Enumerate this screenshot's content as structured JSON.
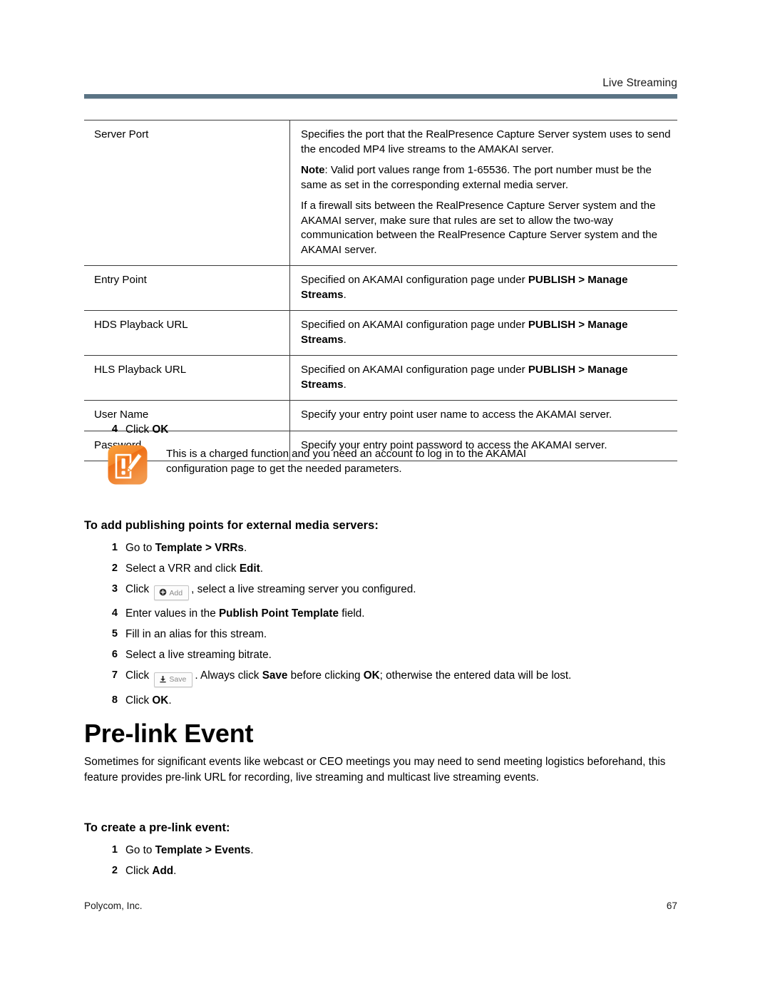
{
  "header": {
    "title": "Live Streaming",
    "rule_color": "#5a7384"
  },
  "table": {
    "rows": [
      {
        "key": "Server Port",
        "paras": [
          {
            "segments": [
              {
                "text": "Specifies the port that the RealPresence Capture Server system uses to send the encoded MP4 live streams to the AMAKAI server.",
                "bold": false
              }
            ]
          },
          {
            "segments": [
              {
                "text": "Note",
                "bold": true
              },
              {
                "text": ": Valid port values range from 1-65536. The port number must be the same as set in the corresponding external media server.",
                "bold": false
              }
            ]
          },
          {
            "segments": [
              {
                "text": "If a firewall sits between the RealPresence Capture Server system and the AKAMAI server, make sure that rules are set to allow the two-way communication between the RealPresence Capture Server system and the AKAMAI server.",
                "bold": false
              }
            ]
          }
        ]
      },
      {
        "key": "Entry Point",
        "paras": [
          {
            "segments": [
              {
                "text": "Specified on AKAMAI configuration page under ",
                "bold": false
              },
              {
                "text": "PUBLISH > Manage Streams",
                "bold": true
              },
              {
                "text": ".",
                "bold": false
              }
            ]
          }
        ]
      },
      {
        "key": "HDS Playback URL",
        "paras": [
          {
            "segments": [
              {
                "text": "Specified on AKAMAI configuration page under ",
                "bold": false
              },
              {
                "text": "PUBLISH > Manage Streams",
                "bold": true
              },
              {
                "text": ".",
                "bold": false
              }
            ]
          }
        ]
      },
      {
        "key": "HLS Playback URL",
        "paras": [
          {
            "segments": [
              {
                "text": "Specified on AKAMAI configuration page under ",
                "bold": false
              },
              {
                "text": "PUBLISH > Manage Streams",
                "bold": true
              },
              {
                "text": ".",
                "bold": false
              }
            ]
          }
        ]
      },
      {
        "key": "User Name",
        "paras": [
          {
            "segments": [
              {
                "text": "Specify your entry point user name to access the AKAMAI server.",
                "bold": false
              }
            ]
          }
        ]
      },
      {
        "key": "Password",
        "paras": [
          {
            "segments": [
              {
                "text": "Specify your entry point password to access the AKAMAI server.",
                "bold": false
              }
            ]
          }
        ]
      }
    ]
  },
  "step_click_ok": {
    "num": "4",
    "prefix": "Click ",
    "bold": "OK"
  },
  "note": {
    "icon": "note-pencil-exclamation-icon",
    "icon_color": "#f07c1e",
    "text": "This is a charged function and you need an account to log in to the AKAMAI configuration page to get the needed parameters."
  },
  "procedure_publishing_points": {
    "heading": "To add publishing points for external media servers:",
    "steps": [
      {
        "num": "1",
        "pre": "Go to ",
        "bold": "Template > VRRs",
        "post": "."
      },
      {
        "num": "2",
        "pre": "Select a VRR and click ",
        "bold": "Edit",
        "post": "."
      },
      {
        "num": "3",
        "pre": "Click ",
        "button": "add",
        "post": ", select a live streaming server you configured."
      },
      {
        "num": "4",
        "pre": "Enter values in the ",
        "bold": "Publish Point Template",
        "post": " field."
      },
      {
        "num": "5",
        "pre": "Fill in an alias for this stream.",
        "bold": "",
        "post": ""
      },
      {
        "num": "6",
        "pre": "Select a live streaming bitrate.",
        "bold": "",
        "post": ""
      },
      {
        "num": "7",
        "pre": "Click ",
        "button": "save",
        "post": ". Always click ",
        "bold2": "Save",
        "mid": " before clicking ",
        "bold3": "OK",
        "tail": "; otherwise the entered data will be lost."
      },
      {
        "num": "8",
        "pre": "Click ",
        "bold": "OK",
        "post": "."
      }
    ]
  },
  "buttons": {
    "add": {
      "label": "Add",
      "icon": "plus-circle-icon"
    },
    "save": {
      "label": "Save",
      "icon": "save-download-icon"
    }
  },
  "prelink": {
    "heading": "Pre-link Event",
    "paragraph": "Sometimes for significant events like webcast or CEO meetings you may need to send meeting logistics beforehand, this feature provides pre-link URL for recording, live streaming and multicast live streaming events."
  },
  "procedure_prelink": {
    "heading": "To create a pre-link event:",
    "steps": [
      {
        "num": "1",
        "pre": "Go to ",
        "bold": "Template > Events",
        "post": "."
      },
      {
        "num": "2",
        "pre": "Click ",
        "bold": "Add",
        "post": "."
      }
    ]
  },
  "footer": {
    "company": "Polycom, Inc.",
    "page_number": "67"
  }
}
